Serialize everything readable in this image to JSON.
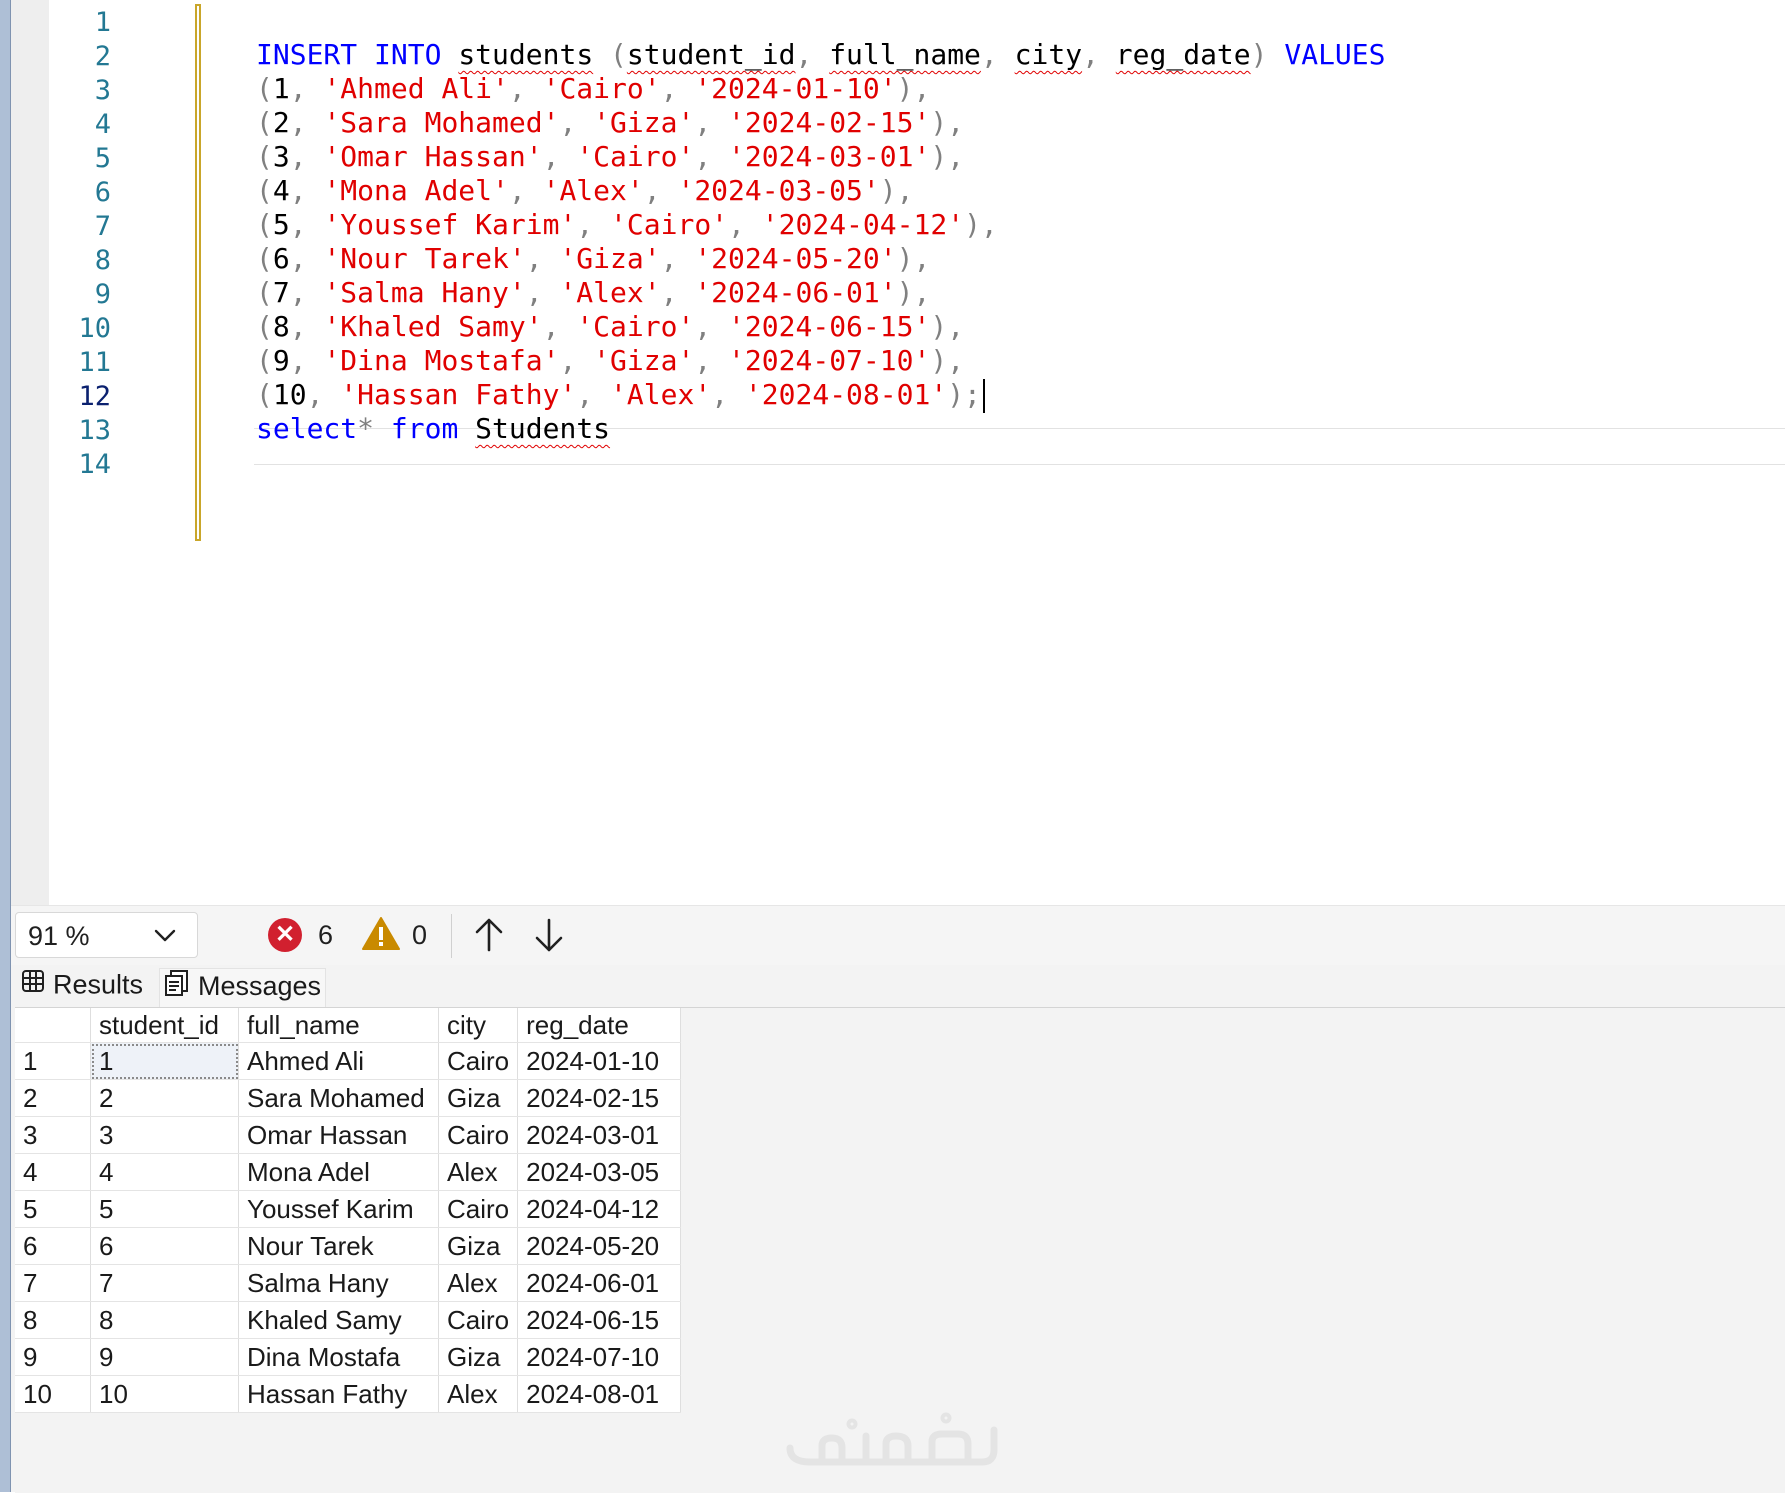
{
  "editor": {
    "line_numbers": [
      "1",
      "2",
      "3",
      "4",
      "5",
      "6",
      "7",
      "8",
      "9",
      "10",
      "11",
      "12",
      "13",
      "14"
    ],
    "active_line": "12",
    "insert": {
      "kw_insert": "INSERT",
      "kw_into": "INTO",
      "table": "students",
      "col1": "student_id",
      "col2": "full_name",
      "col3": "city",
      "col4": "reg_date",
      "kw_values": "VALUES"
    },
    "rows": [
      {
        "id": "1",
        "name": "'Ahmed Ali'",
        "city": "'Cairo'",
        "date": "'2024-01-10'",
        "end": "),"
      },
      {
        "id": "2",
        "name": "'Sara Mohamed'",
        "city": "'Giza'",
        "date": "'2024-02-15'",
        "end": "),"
      },
      {
        "id": "3",
        "name": "'Omar Hassan'",
        "city": "'Cairo'",
        "date": "'2024-03-01'",
        "end": "),"
      },
      {
        "id": "4",
        "name": "'Mona Adel'",
        "city": "'Alex'",
        "date": "'2024-03-05'",
        "end": "),"
      },
      {
        "id": "5",
        "name": "'Youssef Karim'",
        "city": "'Cairo'",
        "date": "'2024-04-12'",
        "end": "),"
      },
      {
        "id": "6",
        "name": "'Nour Tarek'",
        "city": "'Giza'",
        "date": "'2024-05-20'",
        "end": "),"
      },
      {
        "id": "7",
        "name": "'Salma Hany'",
        "city": "'Alex'",
        "date": "'2024-06-01'",
        "end": "),"
      },
      {
        "id": "8",
        "name": "'Khaled Samy'",
        "city": "'Cairo'",
        "date": "'2024-06-15'",
        "end": "),"
      },
      {
        "id": "9",
        "name": "'Dina Mostafa'",
        "city": "'Giza'",
        "date": "'2024-07-10'",
        "end": "),"
      },
      {
        "id": "10",
        "name": "'Hassan Fathy'",
        "city": "'Alex'",
        "date": "'2024-08-01'",
        "end": ");"
      }
    ],
    "select": {
      "kw_select": "select",
      "star": "*",
      "kw_from": "from",
      "table": "Students"
    }
  },
  "statusbar": {
    "zoom": "91 %",
    "errors": "6",
    "warnings": "0"
  },
  "results": {
    "tabs": {
      "results": "Results",
      "messages": "Messages"
    },
    "columns": [
      "student_id",
      "full_name",
      "city",
      "reg_date"
    ],
    "rows": [
      [
        "1",
        "1",
        "Ahmed Ali",
        "Cairo",
        "2024-01-10"
      ],
      [
        "2",
        "2",
        "Sara Mohamed",
        "Giza",
        "2024-02-15"
      ],
      [
        "3",
        "3",
        "Omar Hassan",
        "Cairo",
        "2024-03-01"
      ],
      [
        "4",
        "4",
        "Mona Adel",
        "Alex",
        "2024-03-05"
      ],
      [
        "5",
        "5",
        "Youssef Karim",
        "Cairo",
        "2024-04-12"
      ],
      [
        "6",
        "6",
        "Nour Tarek",
        "Giza",
        "2024-05-20"
      ],
      [
        "7",
        "7",
        "Salma Hany",
        "Alex",
        "2024-06-01"
      ],
      [
        "8",
        "8",
        "Khaled Samy",
        "Cairo",
        "2024-06-15"
      ],
      [
        "9",
        "9",
        "Dina Mostafa",
        "Giza",
        "2024-07-10"
      ],
      [
        "10",
        "10",
        "Hassan Fathy",
        "Alex",
        "2024-08-01"
      ]
    ]
  },
  "watermark": "خمسات",
  "colors": {
    "keyword": "#0000ff",
    "string": "#e00000",
    "line_number": "#237893",
    "error": "#d1202f",
    "warning": "#c98a00"
  }
}
